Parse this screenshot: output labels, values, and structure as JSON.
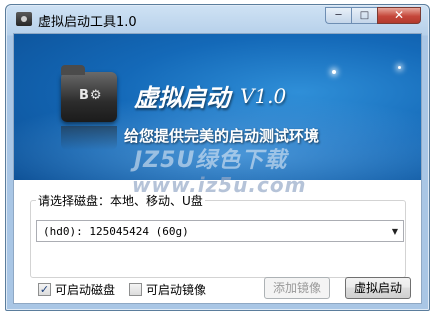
{
  "window": {
    "title": "虚拟启动工具1.0",
    "controls": {
      "minimize": "─",
      "maximize": "□",
      "close": "✕"
    }
  },
  "banner": {
    "title": "虚拟启动",
    "version": "V1.0",
    "slogan": "给您提供完美的启动测试环境",
    "logo_text": "B⚙",
    "watermark_top": "JZ5U绿色下载",
    "watermark_bottom": "www.jz5u.com"
  },
  "disk_group": {
    "legend": "请选择磁盘：本地、移动、U盘",
    "selected_disk": "(hd0): 125045424 (60g)"
  },
  "options": {
    "bootable_disk": {
      "label": "可启动磁盘",
      "checked": true
    },
    "bootable_image": {
      "label": "可启动镜像",
      "checked": false
    }
  },
  "buttons": {
    "add_image": "添加镜像",
    "virtual_boot": "虚拟启动"
  },
  "colors": {
    "banner_blue": "#1469b8",
    "title_bar": "#b6d0ea"
  }
}
